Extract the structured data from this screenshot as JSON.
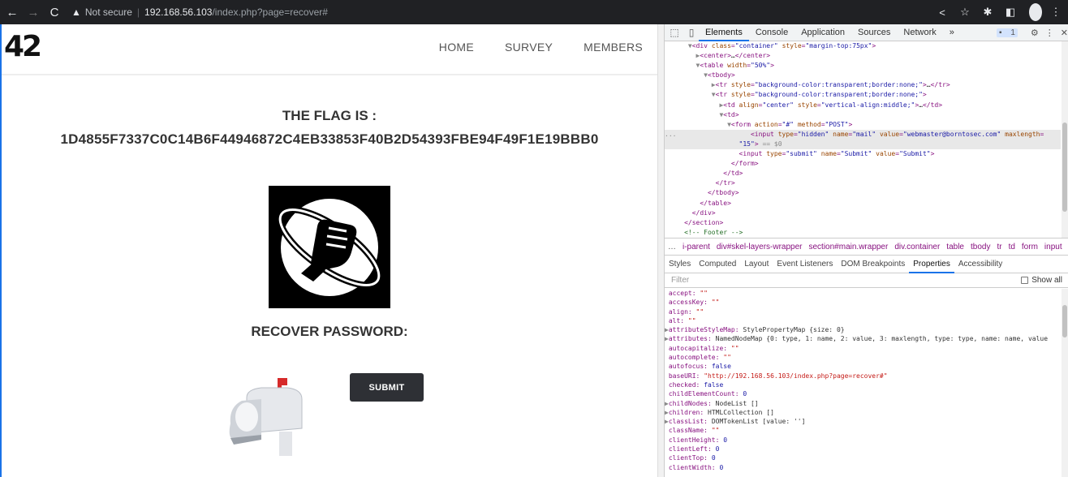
{
  "browser": {
    "back": "←",
    "forward": "→",
    "reload": "C",
    "warning_icon": "▲",
    "not_secure": "Not secure",
    "separator": "|",
    "url_host": "192.168.56.103",
    "url_path": "/index.php?page=recover#"
  },
  "site": {
    "logo": "42",
    "nav": [
      "HOME",
      "SURVEY",
      "MEMBERS"
    ],
    "flag_title": "THE FLAG IS :",
    "flag_value": "1D4855F7337C0C14B6F44946872C4EB33853F40B2D54393FBE94F49F1E19BBB0",
    "recover_title": "RECOVER PASSWORD:",
    "submit_label": "SUBMIT"
  },
  "devtools": {
    "tabs": [
      "Elements",
      "Console",
      "Application",
      "Sources",
      "Network",
      "»"
    ],
    "active_tab": "Elements",
    "issues_badge": "1",
    "elements_lines": [
      {
        "indent": "      ",
        "html": "<span class='dim'>▼</span><span class='tag'>&lt;div </span><span class='attr'>class</span>=<span class='val'>\"container\"</span> <span class='attr'>style</span>=<span class='val'>\"margin-top:75px\"</span><span class='tag'>&gt;</span>"
      },
      {
        "indent": "        ",
        "html": "<span class='dim'>▶</span><span class='tag'>&lt;center&gt;</span><span class='txt'>…</span><span class='tag'>&lt;/center&gt;</span>"
      },
      {
        "indent": "        ",
        "html": "<span class='dim'>▼</span><span class='tag'>&lt;table </span><span class='attr'>width</span>=<span class='val'>\"50%\"</span><span class='tag'>&gt;</span>"
      },
      {
        "indent": "          ",
        "html": "<span class='dim'>▼</span><span class='tag'>&lt;tbody&gt;</span>"
      },
      {
        "indent": "            ",
        "html": "<span class='dim'>▶</span><span class='tag'>&lt;tr </span><span class='attr'>style</span>=<span class='val'>\"background-color:transparent;border:none;\"</span><span class='tag'>&gt;</span><span class='txt'>…</span><span class='tag'>&lt;/tr&gt;</span>"
      },
      {
        "indent": "            ",
        "html": "<span class='dim'>▼</span><span class='tag'>&lt;tr </span><span class='attr'>style</span>=<span class='val'>\"background-color:transparent;border:none;\"</span><span class='tag'>&gt;</span>"
      },
      {
        "indent": "              ",
        "html": "<span class='dim'>▶</span><span class='tag'>&lt;td </span><span class='attr'>align</span>=<span class='val'>\"center\"</span> <span class='attr'>style</span>=<span class='val'>\"vertical-align:middle;\"</span><span class='tag'>&gt;</span><span class='txt'>…</span><span class='tag'>&lt;/td&gt;</span>"
      },
      {
        "indent": "              ",
        "html": "<span class='dim'>▼</span><span class='tag'>&lt;td&gt;</span>"
      },
      {
        "indent": "                ",
        "html": "<span class='dim'>▼</span><span class='tag'>&lt;form </span><span class='attr'>action</span>=<span class='val'>\"#\"</span> <span class='attr'>method</span>=<span class='val'>\"POST\"</span><span class='tag'>&gt;</span>"
      },
      {
        "indent": "...                   ",
        "html": "<span class='tag'>&lt;input </span><span class='attr'>type</span>=<span class='val'>\"hidden\"</span> <span class='attr'>name</span>=<span class='val'>\"mail\"</span> <span class='attr'>value</span>=<span class='val'>\"webmaster@borntosec.com\"</span> <span class='attr'>maxlength</span>=",
        "sel": true
      },
      {
        "indent": "                   ",
        "html": "<span class='val'>\"15\"</span><span class='tag'>&gt;</span> <span class='dim'>== $0</span>",
        "sel": true
      },
      {
        "indent": "                   ",
        "html": "<span class='tag'>&lt;input </span><span class='attr'>type</span>=<span class='val'>\"submit\"</span> <span class='attr'>name</span>=<span class='val'>\"Submit\"</span> <span class='attr'>value</span>=<span class='val'>\"Submit\"</span><span class='tag'>&gt;</span>"
      },
      {
        "indent": "                 ",
        "html": "<span class='tag'>&lt;/form&gt;</span>"
      },
      {
        "indent": "               ",
        "html": "<span class='tag'>&lt;/td&gt;</span>"
      },
      {
        "indent": "             ",
        "html": "<span class='tag'>&lt;/tr&gt;</span>"
      },
      {
        "indent": "           ",
        "html": "<span class='tag'>&lt;/tbody&gt;</span>"
      },
      {
        "indent": "         ",
        "html": "<span class='tag'>&lt;/table&gt;</span>"
      },
      {
        "indent": "       ",
        "html": "<span class='tag'>&lt;/div&gt;</span>"
      },
      {
        "indent": "     ",
        "html": "<span class='tag'>&lt;/section&gt;</span>"
      },
      {
        "indent": "     ",
        "html": "<span class='cmt'>&lt;!-- Footer --&gt;</span>"
      }
    ],
    "breadcrumbs_lead": "…",
    "breadcrumbs": [
      "i-parent",
      "div#skel-layers-wrapper",
      "section#main.wrapper",
      "div.container",
      "table",
      "tbody",
      "tr",
      "td",
      "form",
      "input",
      "…"
    ],
    "subtabs": [
      "Styles",
      "Computed",
      "Layout",
      "Event Listeners",
      "DOM Breakpoints",
      "Properties",
      "Accessibility"
    ],
    "active_subtab": "Properties",
    "filter_placeholder": "Filter",
    "show_all": "Show all",
    "properties": [
      {
        "arrow": "",
        "key": "accept",
        "val": "\"\"",
        "kind": "s"
      },
      {
        "arrow": "",
        "key": "accessKey",
        "val": "\"\"",
        "kind": "s"
      },
      {
        "arrow": "",
        "key": "align",
        "val": "\"\"",
        "kind": "s"
      },
      {
        "arrow": "",
        "key": "alt",
        "val": "\"\"",
        "kind": "s"
      },
      {
        "arrow": "▶",
        "key": "attributeStyleMap",
        "val": "StylePropertyMap {size: 0}",
        "kind": "o"
      },
      {
        "arrow": "▶",
        "key": "attributes",
        "val": "NamedNodeMap {0: type, 1: name, 2: value, 3: maxlength, type: type, name: name, value",
        "kind": "o"
      },
      {
        "arrow": "",
        "key": "autocapitalize",
        "val": "\"\"",
        "kind": "s"
      },
      {
        "arrow": "",
        "key": "autocomplete",
        "val": "\"\"",
        "kind": "s"
      },
      {
        "arrow": "",
        "key": "autofocus",
        "val": "false",
        "kind": "n"
      },
      {
        "arrow": "",
        "key": "baseURI",
        "val": "\"http://192.168.56.103/index.php?page=recover#\"",
        "kind": "s"
      },
      {
        "arrow": "",
        "key": "checked",
        "val": "false",
        "kind": "n"
      },
      {
        "arrow": "",
        "key": "childElementCount",
        "val": "0",
        "kind": "n"
      },
      {
        "arrow": "▶",
        "key": "childNodes",
        "val": "NodeList []",
        "kind": "o"
      },
      {
        "arrow": "▶",
        "key": "children",
        "val": "HTMLCollection []",
        "kind": "o"
      },
      {
        "arrow": "▶",
        "key": "classList",
        "val": "DOMTokenList [value: '']",
        "kind": "o"
      },
      {
        "arrow": "",
        "key": "className",
        "val": "\"\"",
        "kind": "s"
      },
      {
        "arrow": "",
        "key": "clientHeight",
        "val": "0",
        "kind": "n"
      },
      {
        "arrow": "",
        "key": "clientLeft",
        "val": "0",
        "kind": "n"
      },
      {
        "arrow": "",
        "key": "clientTop",
        "val": "0",
        "kind": "n"
      },
      {
        "arrow": "",
        "key": "clientWidth",
        "val": "0",
        "kind": "n"
      }
    ]
  },
  "colors": {
    "chrome_bg": "#202124",
    "button_bg": "#2e3035",
    "devtools_accent": "#1a73e8"
  }
}
